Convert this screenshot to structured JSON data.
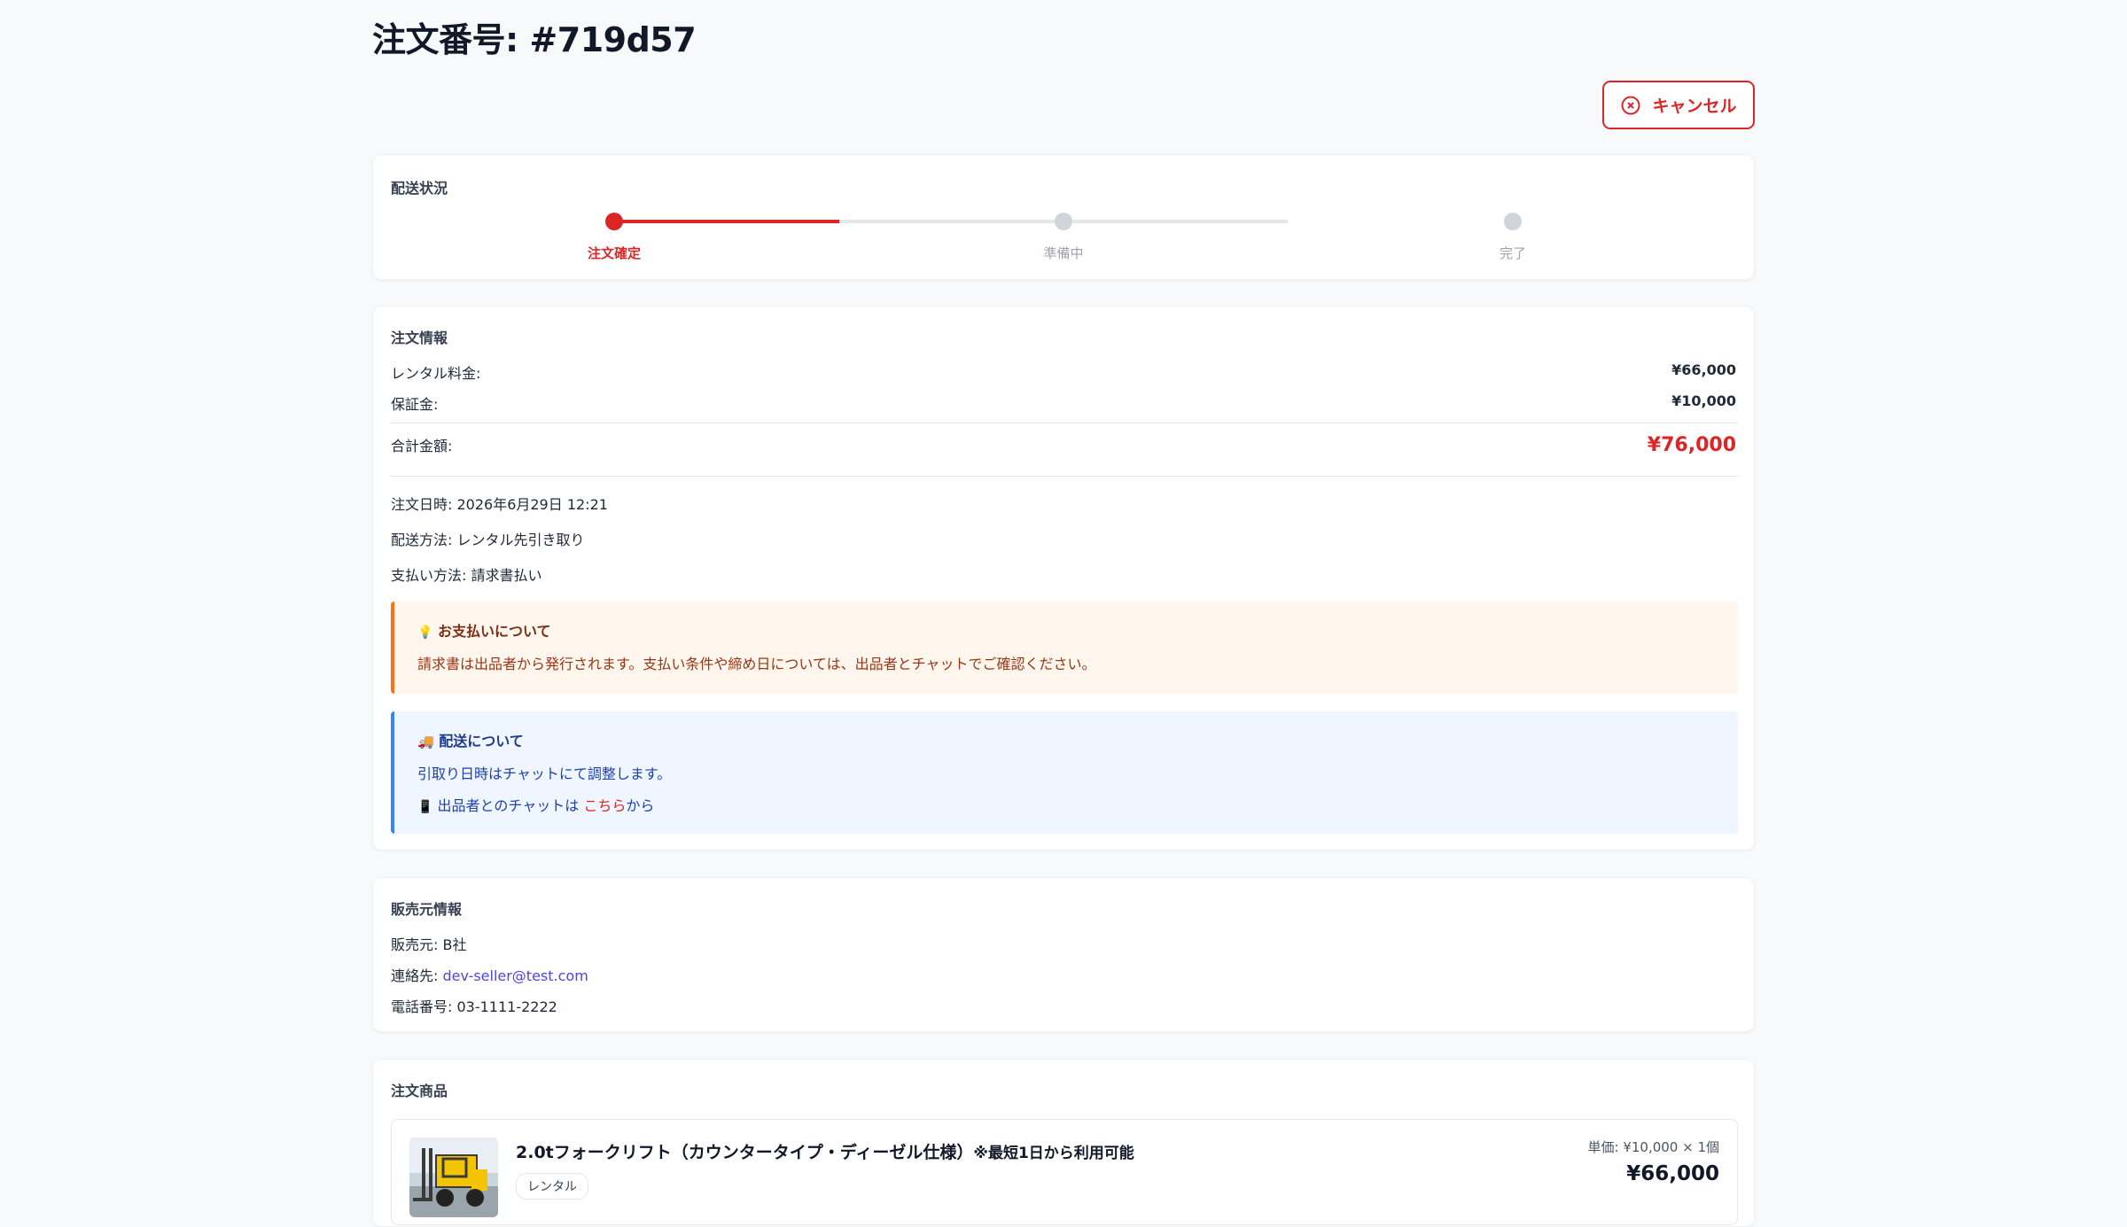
{
  "page": {
    "title": "注文番号: #719d57",
    "cancel_label": "キャンセル"
  },
  "shipping_status": {
    "heading": "配送状況",
    "steps": [
      {
        "label": "注文確定",
        "state": "done"
      },
      {
        "label": "準備中",
        "state": "pending"
      },
      {
        "label": "完了",
        "state": "pending"
      }
    ],
    "progress_fraction": 0.5
  },
  "order_info": {
    "heading": "注文情報",
    "rental_fee_label": "レンタル料金:",
    "rental_fee_value": "¥66,000",
    "deposit_label": "保証金:",
    "deposit_value": "¥10,000",
    "total_label": "合計金額:",
    "total_value": "¥76,000",
    "order_date": "注文日時: 2026年6月29日 12:21",
    "delivery_method": "配送方法: レンタル先引き取り",
    "payment_method": "支払い方法: 請求書払い"
  },
  "payment_notice": {
    "icon": "lightbulb-icon",
    "icon_glyph": "💡",
    "title": "お支払いについて",
    "text": "請求書は出品者から発行されます。支払い条件や締め日については、出品者とチャットでご確認ください。"
  },
  "delivery_notice": {
    "icon": "truck-icon",
    "icon_glyph": "🚚",
    "title": "配送について",
    "text": "引取り日時はチャットにて調整します。",
    "chat_icon": "phone-icon",
    "chat_icon_glyph": "📱",
    "chat_prefix": "出品者とのチャットは",
    "chat_link": "こちら",
    "chat_suffix": "から"
  },
  "seller_info": {
    "heading": "販売元情報",
    "seller_label": "販売元:",
    "seller_value": "B社",
    "contact_label": "連絡先:",
    "contact_email": "dev-seller@test.com",
    "phone": "電話番号: 03-1111-2222"
  },
  "products": {
    "heading": "注文商品",
    "items": [
      {
        "name": "2.0tフォークリフト（カウンタータイプ・ディーゼル仕様）",
        "note": "※最短1日から利用可能",
        "tag": "レンタル",
        "unit_price": "単価: ¥10,000 × 1個",
        "price": "¥66,000"
      }
    ]
  },
  "colors": {
    "accent_red": "#dc2626",
    "pending_gray": "#d1d5db",
    "payment_notice_bg": "#fff7ed",
    "payment_notice_border": "#f97316",
    "delivery_notice_bg": "#eff6ff",
    "delivery_notice_border": "#3b82f6"
  }
}
